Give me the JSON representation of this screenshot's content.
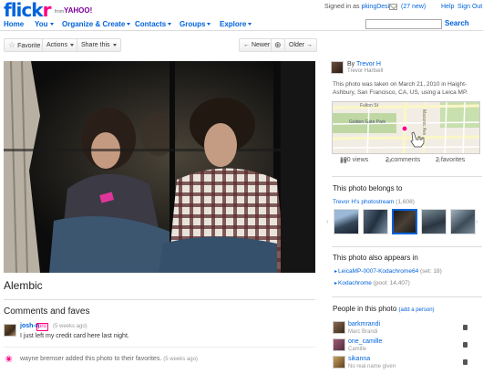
{
  "header": {
    "logo_part1": "flick",
    "logo_part2": "r",
    "from_text": "from",
    "yahoo_text": "YAHOO!",
    "signed_in_as": "Signed in as",
    "username": "pkingDesign",
    "mail_new": "(27 new)",
    "help": "Help",
    "sign_out": "Sign Out"
  },
  "nav": {
    "items": [
      {
        "label": "Home"
      },
      {
        "label": "You"
      },
      {
        "label": "Organize & Create"
      },
      {
        "label": "Contacts"
      },
      {
        "label": "Groups"
      },
      {
        "label": "Explore"
      }
    ],
    "search_value": "",
    "search_button": "Search"
  },
  "toolbar": {
    "favorite": "Favorite",
    "actions": "Actions",
    "share": "Share this",
    "newer": "← Newer",
    "older": "Older →"
  },
  "photo": {
    "title": "Alembic"
  },
  "comments": {
    "heading": "Comments and faves",
    "comment_user": "josh-n",
    "pro_badge": "pro",
    "comment_when": "(5 weeks ago)",
    "comment_text": "I just left my credit card here last night.",
    "fave_user": "wayne bremser",
    "fave_text": "added this photo to their favorites.",
    "fave_when": "(5 weeks ago)"
  },
  "sidebar": {
    "by": "By",
    "owner": "Trevor H",
    "owner_real": "Trevor Hartsell",
    "taken_text": "This photo was taken on March 21, 2010 in Haight-Ashbury, San Francisco, CA, US, using a Leica MP.",
    "views": "100 views",
    "comments": "2 comments",
    "favorites": "2 favorites",
    "belongs_heading": "This photo belongs to",
    "stream_link": "Trevor H's photostream",
    "stream_count": "(1,608)",
    "appears_heading": "This photo also appears in",
    "sets": [
      {
        "name": "LeicaMP-0007-Kodachrome64",
        "meta": "(set: 18)"
      },
      {
        "name": "Kodachrome",
        "meta": "(pool: 14,407)"
      }
    ],
    "people_heading": "People in this photo",
    "add_person": "(add a person)",
    "people": [
      {
        "name": "barkmrandi",
        "real": "Marc Brandi"
      },
      {
        "name": "one_camille",
        "real": "Camille"
      },
      {
        "name": "sikanna",
        "real": "No real name given"
      }
    ]
  },
  "map": {
    "labels": [
      "Golden Gate Park",
      "Fulton St",
      "Masonic Ave"
    ]
  }
}
